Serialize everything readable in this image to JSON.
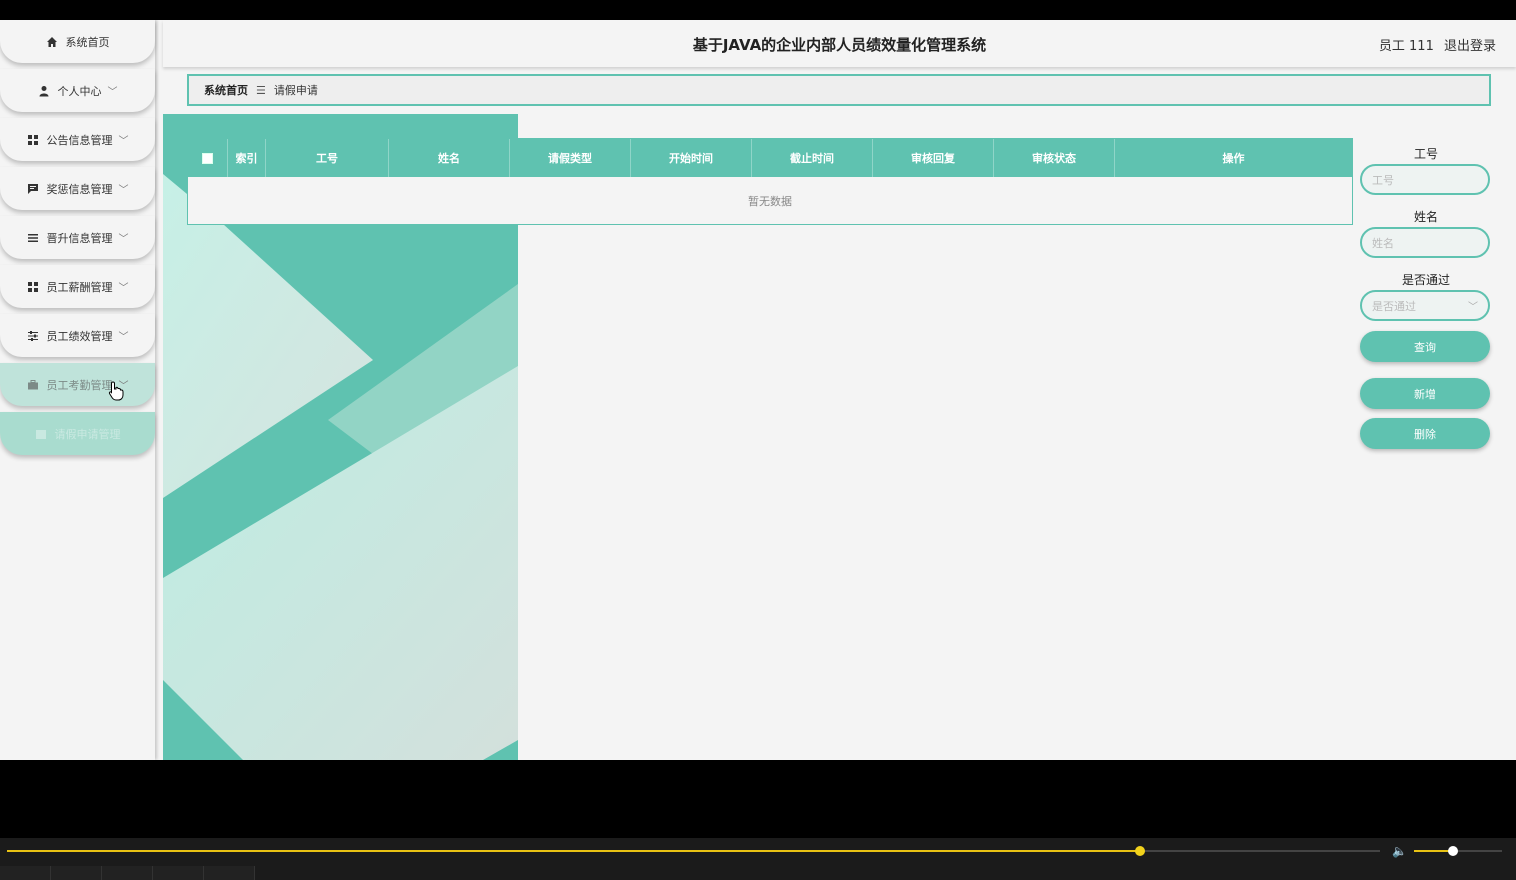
{
  "header": {
    "title": "基于JAVA的企业内部人员绩效量化管理系统",
    "user_label": "员工 111",
    "logout_label": "退出登录"
  },
  "sidebar": {
    "items": [
      {
        "label": "系统首页",
        "icon": "home-icon"
      },
      {
        "label": "个人中心",
        "icon": "user-icon"
      },
      {
        "label": "公告信息管理",
        "icon": "grid-icon"
      },
      {
        "label": "奖惩信息管理",
        "icon": "message-icon"
      },
      {
        "label": "晋升信息管理",
        "icon": "list-icon"
      },
      {
        "label": "员工薪酬管理",
        "icon": "grid-icon"
      },
      {
        "label": "员工绩效管理",
        "icon": "sliders-icon"
      },
      {
        "label": "员工考勤管理",
        "icon": "briefcase-icon"
      },
      {
        "label": "请假申请管理",
        "icon": "calendar-icon"
      }
    ]
  },
  "breadcrumb": {
    "home": "系统首页",
    "separator": "☰",
    "current": "请假申请"
  },
  "table": {
    "columns": [
      "索引",
      "工号",
      "姓名",
      "请假类型",
      "开始时间",
      "截止时间",
      "审核回复",
      "审核状态",
      "操作"
    ],
    "empty_text": "暂无数据"
  },
  "search": {
    "fields": [
      {
        "label": "工号",
        "placeholder": "工号"
      },
      {
        "label": "姓名",
        "placeholder": "姓名"
      }
    ],
    "select": {
      "label": "是否通过",
      "placeholder": "是否通过"
    },
    "query_button": "查询",
    "add_button": "新增",
    "delete_button": "删除"
  },
  "player": {
    "progress": 0.825,
    "volume": 0.44
  },
  "colors": {
    "accent": "#5fc2b0",
    "progress": "#e8c214"
  }
}
